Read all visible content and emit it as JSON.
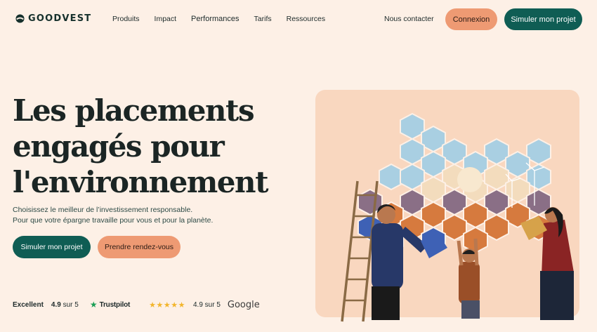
{
  "brand": {
    "name": "GOODVEST",
    "logo_icon": "goodvest-leaf-icon"
  },
  "nav": {
    "links": [
      "Produits",
      "Impact",
      "Performances",
      "Tarifs",
      "Ressources"
    ],
    "contact": "Nous contacter",
    "login": "Connexion",
    "simulate": "Simuler mon projet"
  },
  "hero": {
    "headline": [
      "Les placements",
      "engagés pour",
      "l'environnement"
    ],
    "subtitle": [
      "Choisissez le meilleur de l’investissement responsable.",
      "Pour que votre épargne travaille pour vous et pour la planète."
    ],
    "cta_primary": "Simuler mon projet",
    "cta_secondary": "Prendre rendez-vous"
  },
  "ratings": {
    "trustpilot_label": "Excellent",
    "trustpilot_score": "4.9",
    "trustpilot_suffix": "sur 5",
    "trustpilot_name": "Trustpilot",
    "trustpilot_icon": "trustpilot-star-icon",
    "google_stars": 5,
    "google_score": "4.9 sur 5",
    "google_name": "Google"
  },
  "colors": {
    "background": "#fdf0e6",
    "primary": "#0f5d54",
    "accent": "#ee9a73",
    "illustration_bg": "#f9d7bf"
  }
}
